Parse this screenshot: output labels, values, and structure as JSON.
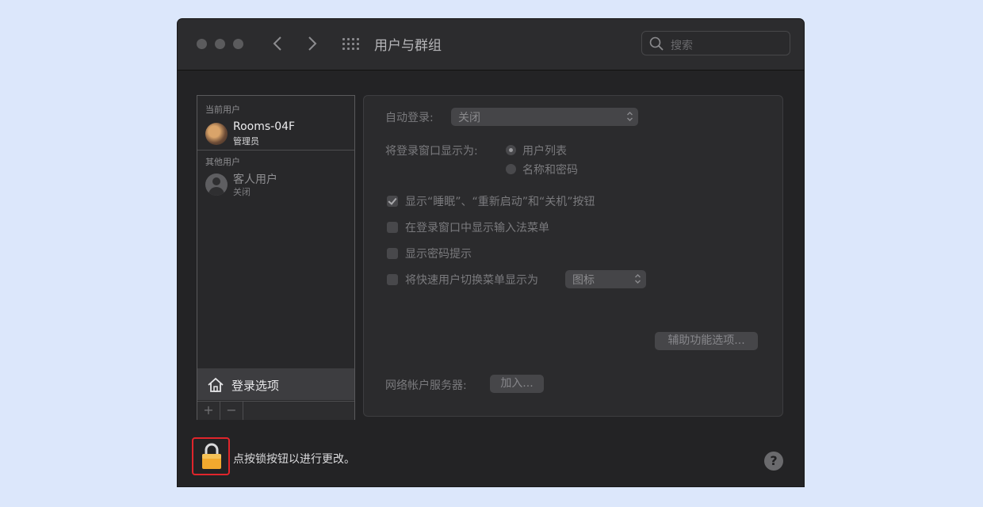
{
  "window": {
    "title": "用户与群组"
  },
  "search": {
    "placeholder": "搜索"
  },
  "sidebar": {
    "current_users_label": "当前用户",
    "current_user": {
      "name": "Rooms-04F",
      "role": "管理员"
    },
    "other_users_label": "其他用户",
    "guest_user": {
      "name": "客人用户",
      "status": "关闭"
    },
    "login_options_label": "登录选项",
    "add_button": "+",
    "remove_button": "−"
  },
  "panel": {
    "auto_login_label": "自动登录:",
    "auto_login_value": "关闭",
    "display_login_window_label": "将登录窗口显示为:",
    "radio_user_list": "用户列表",
    "radio_name_password": "名称和密码",
    "checkbox_show_buttons": "显示“睡眠”、“重新启动”和“关机”按钮",
    "checkbox_input_menu": "在登录窗口中显示输入法菜单",
    "checkbox_password_hints": "显示密码提示",
    "checkbox_fast_user_switch": "将快速用户切换菜单显示为",
    "fast_user_switch_value": "图标",
    "accessibility_button": "辅助功能选项...",
    "network_server_label": "网络帐户服务器:",
    "join_button": "加入..."
  },
  "footer": {
    "lock_text": "点按锁按钮以进行更改。",
    "help_button": "?"
  },
  "state": {
    "show_buttons_checked": true,
    "input_menu_checked": false,
    "password_hints_checked": false,
    "fast_user_switch_checked": false,
    "selected_login_display": "用户列表"
  }
}
